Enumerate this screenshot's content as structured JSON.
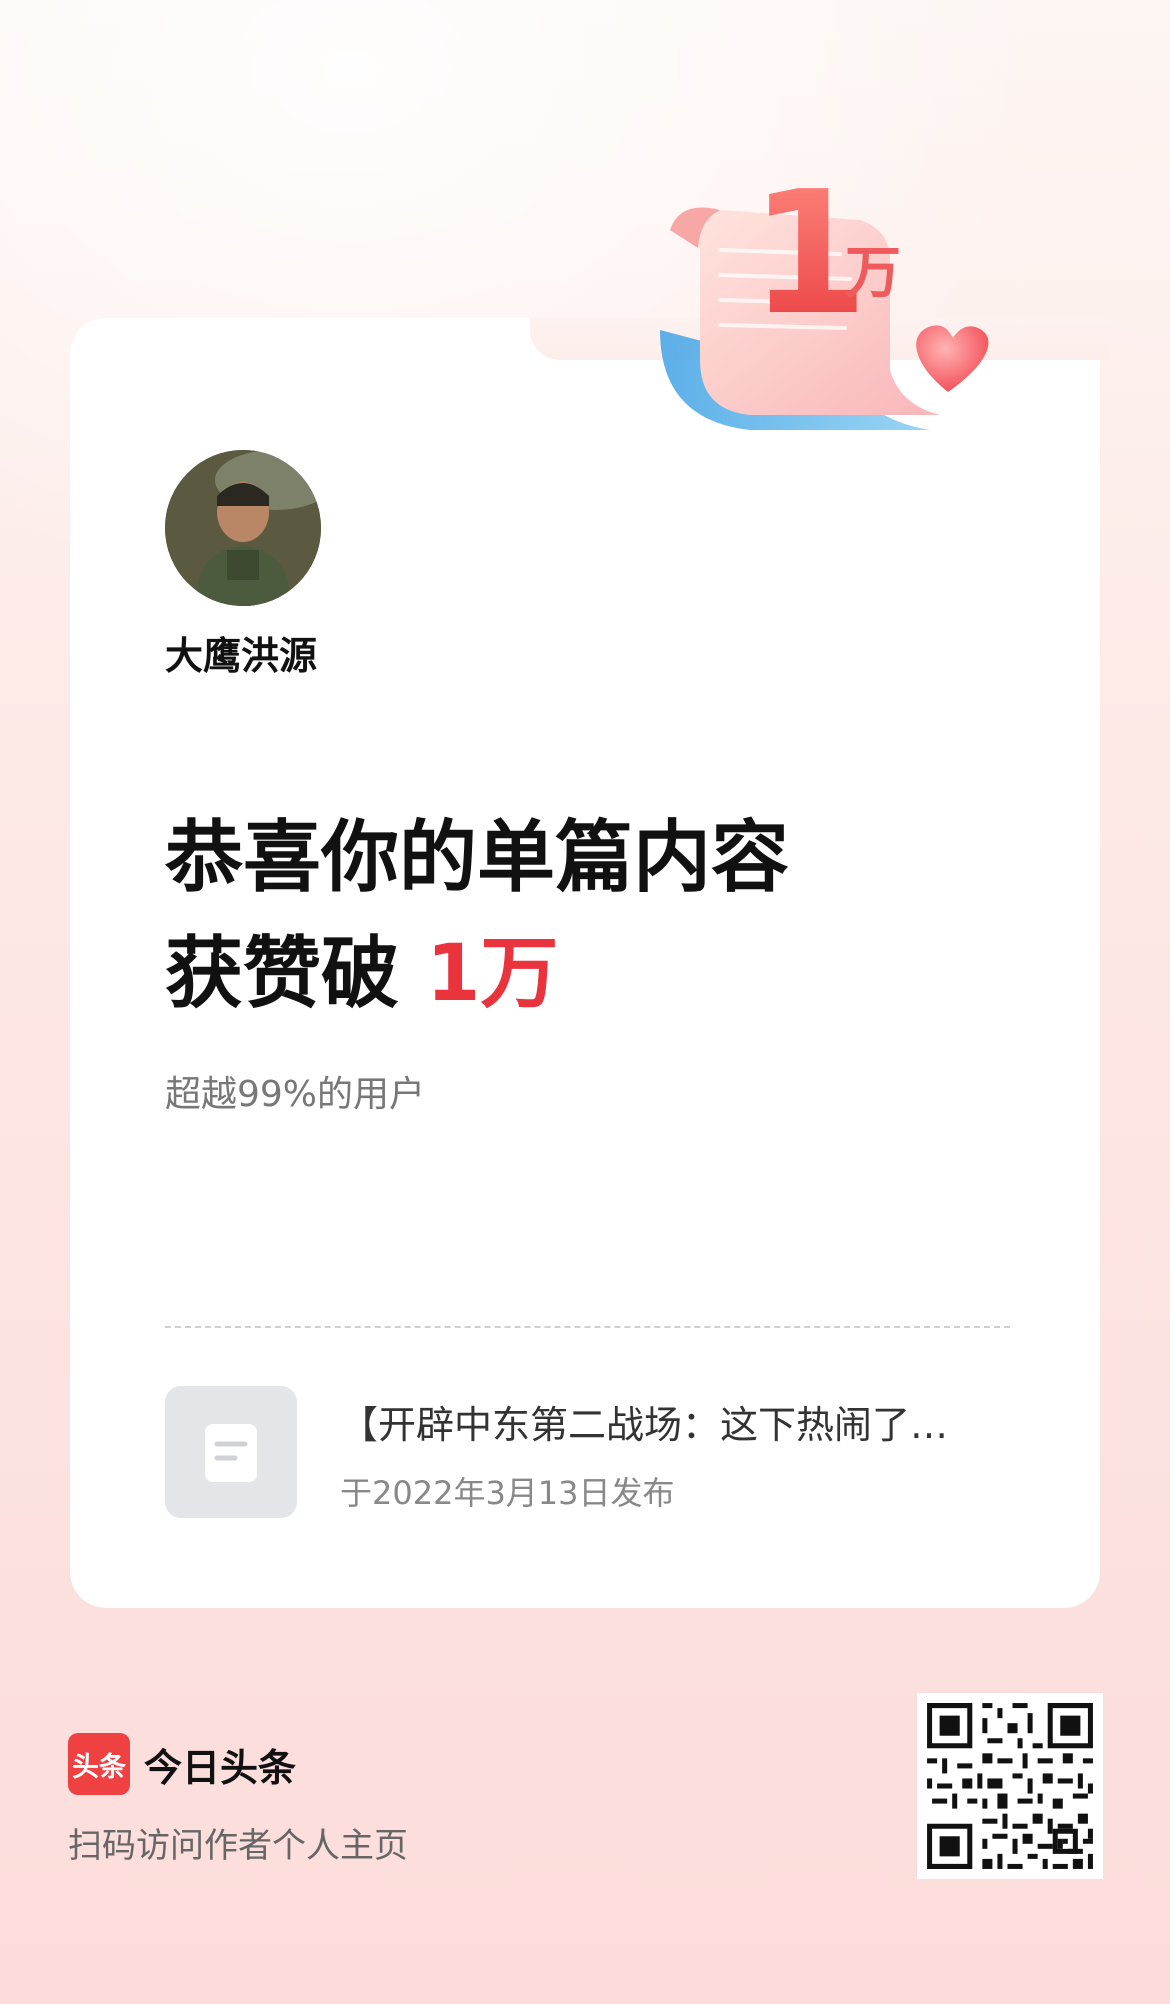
{
  "milestone": {
    "badge_number": "1",
    "badge_unit": "万"
  },
  "author": {
    "name": "大鹰洪源"
  },
  "headline": {
    "line1": "恭喜你的单篇内容",
    "line2_prefix": "获赞破 ",
    "line2_value": "1万"
  },
  "subline": "超越99%的用户",
  "article": {
    "icon": "document-icon",
    "title": "【开辟中东第二战场：这下热闹了…",
    "date": "于2022年3月13日发布"
  },
  "footer": {
    "logo_text": "头条",
    "brand_name": "今日头条",
    "caption": "扫码访问作者个人主页"
  },
  "colors": {
    "accent": "#e9333d",
    "brand": "#f04142",
    "text_primary": "#111111",
    "text_secondary": "#777777"
  }
}
